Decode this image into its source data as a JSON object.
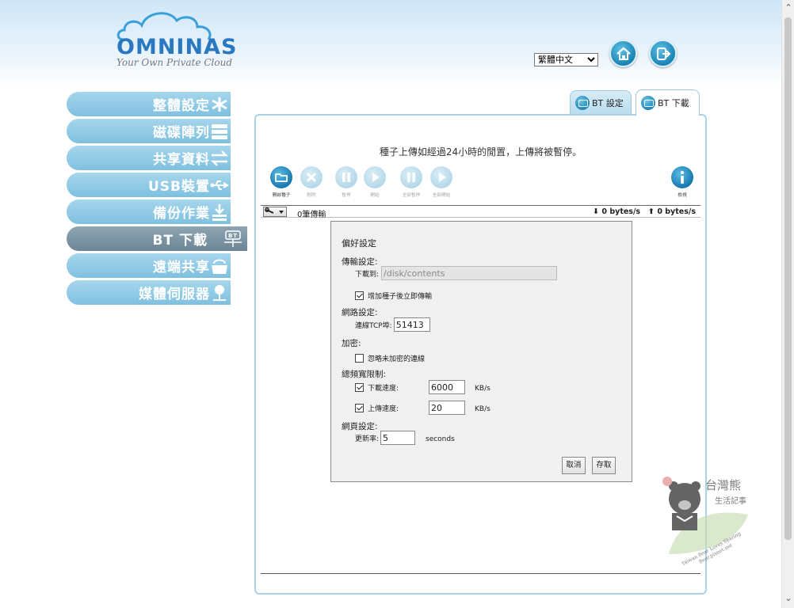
{
  "brand": {
    "name": "OMNINAS",
    "tagline": "Your Own Private Cloud"
  },
  "header": {
    "language": "繁體中文",
    "home_icon": "home-icon",
    "logout_icon": "logout-icon"
  },
  "sidebar": {
    "items": [
      {
        "label": "整體設定",
        "icon": "settings-icon"
      },
      {
        "label": "磁碟陣列",
        "icon": "disk-array-icon"
      },
      {
        "label": "共享資料",
        "icon": "share-arrows-icon"
      },
      {
        "label": "USB裝置",
        "icon": "usb-icon"
      },
      {
        "label": "備份作業",
        "icon": "backup-icon"
      },
      {
        "label": "BT 下載",
        "icon": "bt-icon",
        "active": true
      },
      {
        "label": "遠端共享",
        "icon": "remote-share-icon"
      },
      {
        "label": "媒體伺服器",
        "icon": "media-server-icon"
      }
    ]
  },
  "tabs": [
    {
      "label": "BT 設定",
      "active": false
    },
    {
      "label": "BT 下載",
      "active": true
    }
  ],
  "main": {
    "notice": "種子上傳如經過24小時的閒置，上傳將被暫停。",
    "toolbar": {
      "open": "開啟種子",
      "remove": "刪除",
      "pause": "暫停",
      "start": "開始",
      "pause_all": "全部暫停",
      "start_all": "全部開始",
      "inspect": "檢視"
    },
    "status": {
      "count": "0筆傳輸",
      "down_rate": "0 bytes/s",
      "up_rate": "0 bytes/s"
    }
  },
  "preferences": {
    "title": "偏好設定",
    "transfer_section": "傳輸設定:",
    "download_to_label": "下載到:",
    "download_to_value": "/disk/contents",
    "start_when_added_label": "增加種子後立即傳輸",
    "start_when_added": true,
    "network_section": "網路設定:",
    "tcp_port_label": "連線TCP埠:",
    "tcp_port_value": "51413",
    "encryption_section": "加密:",
    "ignore_unencrypted_label": "忽略未加密的連線",
    "ignore_unencrypted": false,
    "bandwidth_section": "總頻寬限制:",
    "download_speed_label": "下載速度:",
    "download_speed_enabled": true,
    "download_speed_value": "6000",
    "upload_speed_label": "上傳速度:",
    "upload_speed_enabled": true,
    "upload_speed_value": "20",
    "speed_unit": "KB/s",
    "web_section": "網頁設定:",
    "refresh_label": "更新率:",
    "refresh_value": "5",
    "refresh_unit": "seconds",
    "cancel": "取消",
    "save": "存取"
  },
  "watermark": {
    "title": "台灣熊",
    "subtitle": "生活記事",
    "caption": "Taiwan Bear Loves Sharing",
    "site": "Bear.pixnet.net"
  }
}
